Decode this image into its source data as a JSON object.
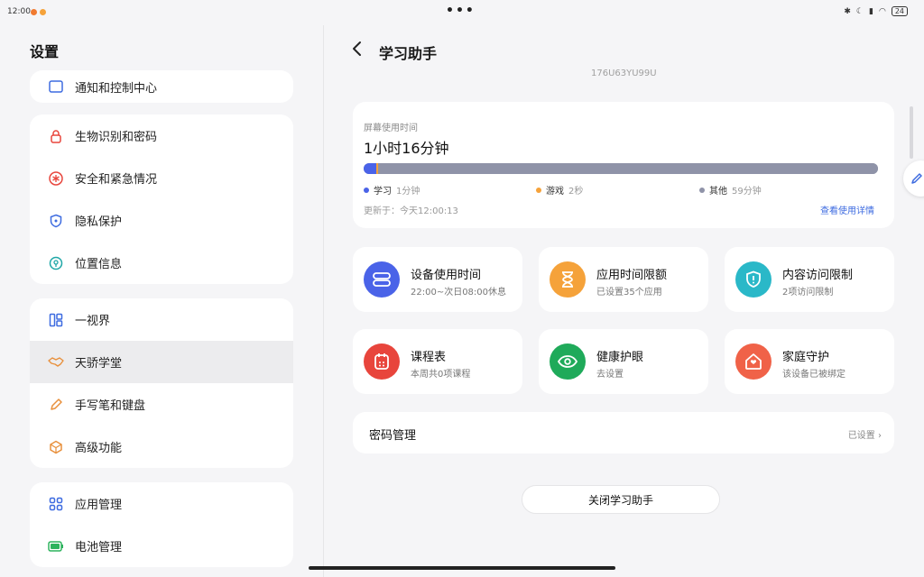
{
  "status": {
    "time": "12:00",
    "more": "•••",
    "battery": "24"
  },
  "sidebar": {
    "title": "设置",
    "groups": [
      [
        {
          "label": "通知和控制中心",
          "icon": "notification-icon",
          "color": "#3d6be0"
        }
      ],
      [
        {
          "label": "生物识别和密码",
          "icon": "lock-icon",
          "color": "#e8453c"
        },
        {
          "label": "安全和紧急情况",
          "icon": "emergency-icon",
          "color": "#e8453c"
        },
        {
          "label": "隐私保护",
          "icon": "shield-icon",
          "color": "#3d6be0"
        },
        {
          "label": "位置信息",
          "icon": "location-icon",
          "color": "#1fa7a7"
        }
      ],
      [
        {
          "label": "一视界",
          "icon": "multiwindow-icon",
          "color": "#3d6be0"
        },
        {
          "label": "天骄学堂",
          "icon": "handshake-icon",
          "color": "#e8903c",
          "active": true
        },
        {
          "label": "手写笔和键盘",
          "icon": "pen-icon",
          "color": "#e8903c"
        },
        {
          "label": "高级功能",
          "icon": "cube-icon",
          "color": "#e8903c"
        }
      ],
      [
        {
          "label": "应用管理",
          "icon": "apps-icon",
          "color": "#3d6be0"
        },
        {
          "label": "电池管理",
          "icon": "battery-icon",
          "color": "#2db35d"
        }
      ]
    ]
  },
  "page": {
    "title": "学习助手",
    "faded_text": "176U63YU99U"
  },
  "usage": {
    "label": "屏幕使用时间",
    "total": "1小时16分钟",
    "segments": [
      {
        "name": "学习",
        "value": "1分钟",
        "minutes": 1,
        "color": "#4a63e8"
      },
      {
        "name": "游戏",
        "value": "2秒",
        "minutes": 0.033,
        "color": "#f5a23a"
      },
      {
        "name": "其他",
        "value": "59分钟",
        "minutes": 59,
        "color": "#8f93a8"
      }
    ],
    "updated": "更新于：今天12:00:13",
    "detail_link": "查看使用详情"
  },
  "features": [
    {
      "title": "设备使用时间",
      "sub": "22:00~次日08:00休息",
      "icon": "device-time-icon",
      "color": "#4a63e8"
    },
    {
      "title": "应用时间限额",
      "sub": "已设置35个应用",
      "icon": "hourglass-icon",
      "color": "#f5a23a"
    },
    {
      "title": "内容访问限制",
      "sub": "2项访问限制",
      "icon": "shield-alert-icon",
      "color": "#2ab8c8"
    },
    {
      "title": "课程表",
      "sub": "本周共0项课程",
      "icon": "calendar-icon",
      "color": "#e8453c"
    },
    {
      "title": "健康护眼",
      "sub": "去设置",
      "icon": "eye-icon",
      "color": "#1faa5a"
    },
    {
      "title": "家庭守护",
      "sub": "该设备已被绑定",
      "icon": "home-guard-icon",
      "color": "#f06248"
    }
  ],
  "password": {
    "title": "密码管理",
    "status": "已设置"
  },
  "close_button": "关闭学习助手"
}
